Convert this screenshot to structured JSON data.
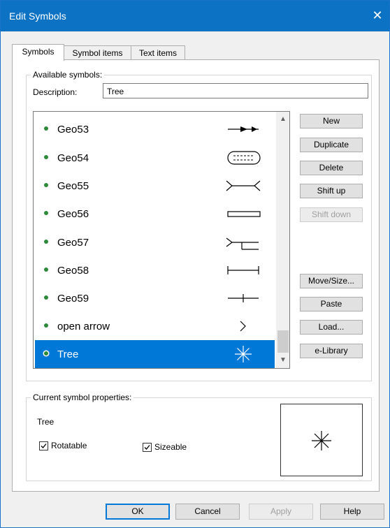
{
  "window": {
    "title": "Edit Symbols",
    "close_glyph": "✕"
  },
  "tabs": [
    {
      "label": "Symbols"
    },
    {
      "label": "Symbol items"
    },
    {
      "label": "Text items"
    }
  ],
  "available": {
    "legend": "Available symbols:",
    "description_label": "Description:",
    "description_value": "Tree"
  },
  "symbols": [
    {
      "name": "Geo53",
      "icon": "arrow-line-icon"
    },
    {
      "name": "Geo54",
      "icon": "rounded-box-icon"
    },
    {
      "name": "Geo55",
      "icon": "forked-ends-line-icon"
    },
    {
      "name": "Geo56",
      "icon": "rectangle-bar-icon"
    },
    {
      "name": "Geo57",
      "icon": "fork-step-line-icon"
    },
    {
      "name": "Geo58",
      "icon": "bracket-line-icon"
    },
    {
      "name": "Geo59",
      "icon": "tick-line-icon"
    },
    {
      "name": "open arrow",
      "icon": "chevron-right-icon"
    },
    {
      "name": "Tree",
      "icon": "asterisk-tree-icon",
      "selected": true
    }
  ],
  "side_buttons": {
    "new": "New",
    "duplicate": "Duplicate",
    "delete": "Delete",
    "shift_up": "Shift up",
    "shift_down": "Shift down",
    "move_size": "Move/Size...",
    "paste": "Paste",
    "load": "Load...",
    "elibrary": "e-Library"
  },
  "current": {
    "legend": "Current symbol properties:",
    "name": "Tree",
    "rotatable_label": "Rotatable",
    "rotatable_checked": true,
    "sizeable_label": "Sizeable",
    "sizeable_checked": true
  },
  "footer": {
    "ok": "OK",
    "cancel": "Cancel",
    "apply": "Apply",
    "help": "Help"
  },
  "colors": {
    "title_bar": "#0b72c4",
    "selection": "#0078d7",
    "dot": "#2c8a39"
  }
}
